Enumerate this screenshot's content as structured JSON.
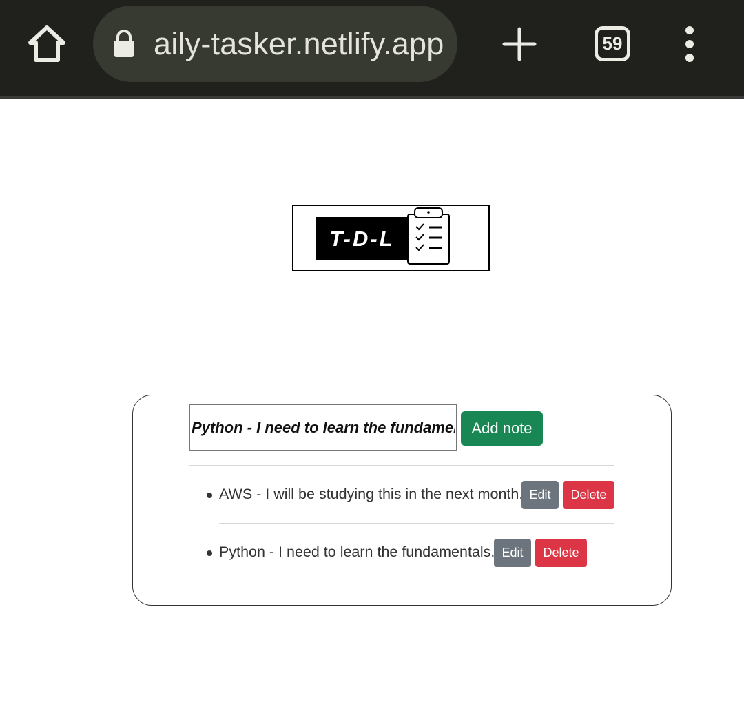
{
  "browser": {
    "url": "aily-tasker.netlify.app",
    "tab_count": "59",
    "icons": {
      "home": "home-icon",
      "lock": "lock-icon",
      "new_tab": "plus-icon",
      "menu": "more-vert-icon"
    }
  },
  "logo": {
    "text": "T-D-L",
    "icon": "clipboard-checklist-icon"
  },
  "composer": {
    "input_value": "Python - I need to learn the fundamentals",
    "add_label": "Add note"
  },
  "notes": [
    {
      "text": "AWS - I will be studying this in the next month.",
      "edit_label": "Edit",
      "delete_label": "Delete"
    },
    {
      "text": "Python - I need to learn the fundamentals.",
      "edit_label": "Edit",
      "delete_label": "Delete"
    }
  ],
  "colors": {
    "browser_bar": "#20211c",
    "url_pill": "#373a30",
    "add_button": "#198754",
    "edit_button": "#6c757d",
    "delete_button": "#dc3545"
  }
}
